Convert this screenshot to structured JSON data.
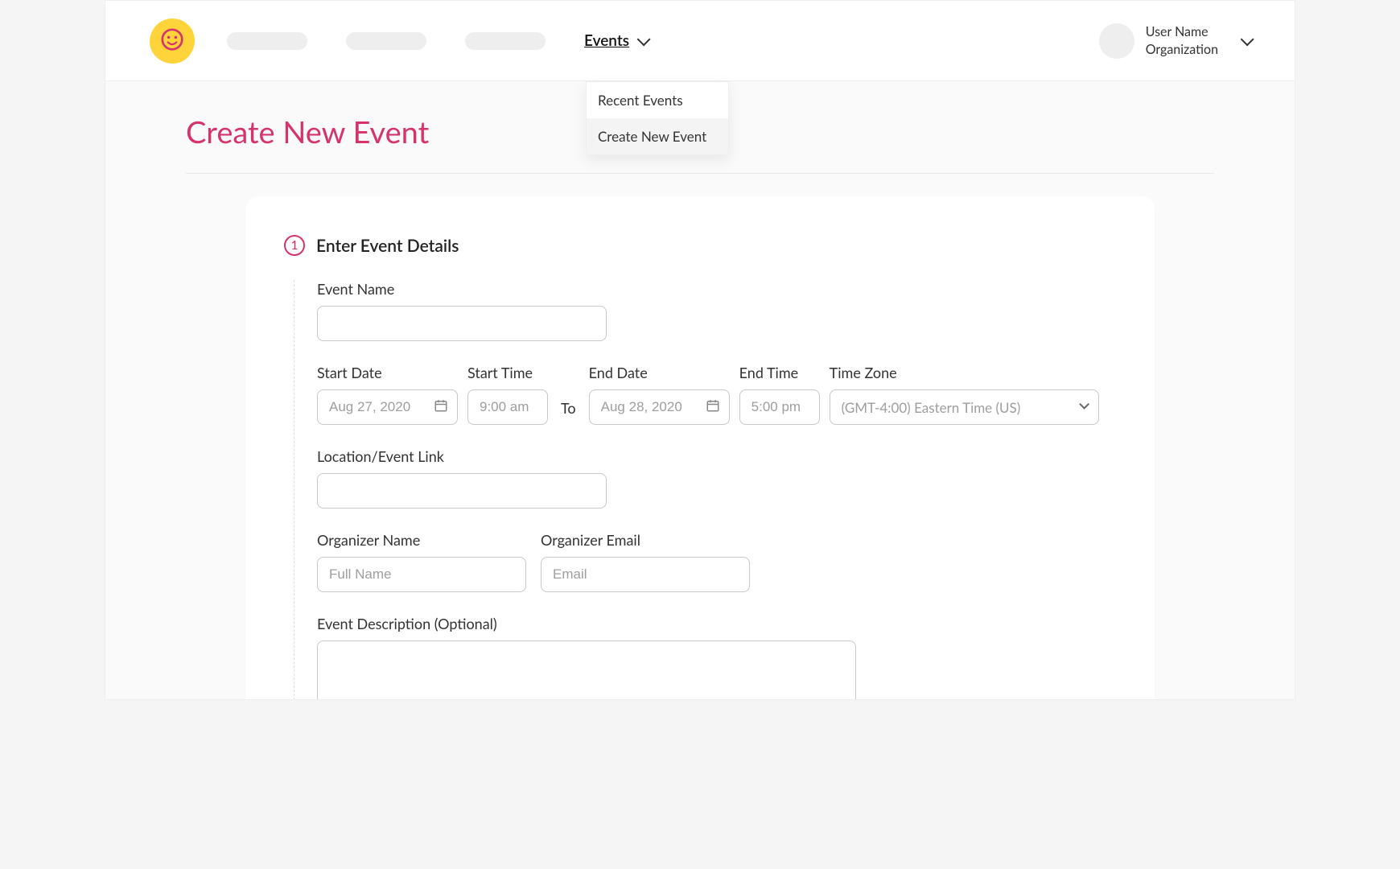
{
  "header": {
    "nav": {
      "events_label": "Events",
      "dropdown": {
        "items": [
          {
            "label": "Recent Events"
          },
          {
            "label": "Create New Event"
          }
        ]
      }
    },
    "user": {
      "name": "User Name",
      "org": "Organization"
    }
  },
  "page": {
    "title": "Create New Event",
    "step": {
      "num": "1",
      "title": "Enter Event Details"
    },
    "form": {
      "event_name_label": "Event Name",
      "event_name_value": "",
      "start_date_label": "Start Date",
      "start_date_placeholder": "Aug 27, 2020",
      "start_time_label": "Start Time",
      "start_time_placeholder": "9:00 am",
      "to_label": "To",
      "end_date_label": "End Date",
      "end_date_placeholder": "Aug 28, 2020",
      "end_time_label": "End Time",
      "end_time_placeholder": "5:00 pm",
      "timezone_label": "Time Zone",
      "timezone_value": "(GMT-4:00) Eastern Time (US)",
      "location_label": "Location/Event Link",
      "location_value": "",
      "org_name_label": "Organizer Name",
      "org_name_placeholder": "Full Name",
      "org_email_label": "Organizer Email",
      "org_email_placeholder": "Email",
      "description_label": "Event Description (Optional)",
      "description_value": ""
    }
  }
}
